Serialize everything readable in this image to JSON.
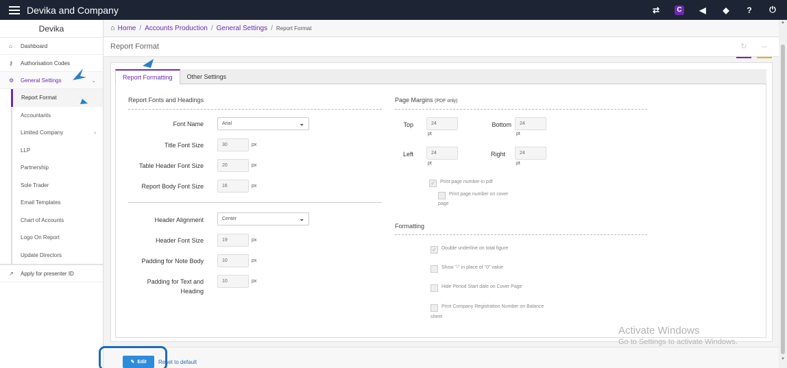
{
  "app": {
    "title": "Devika and Company"
  },
  "topbar_icons": [
    "exchange-icon",
    "brand-c-icon",
    "megaphone-icon",
    "tag-icon",
    "help-icon",
    "power-icon"
  ],
  "sidebar": {
    "company": "Devika",
    "items": [
      {
        "label": "Dashboard",
        "icon": "dashboard-icon"
      },
      {
        "label": "Authorisation Codes",
        "icon": "key-icon"
      },
      {
        "label": "General Settings",
        "icon": "cogs-icon"
      }
    ],
    "sub_items": [
      {
        "label": "Report Format"
      },
      {
        "label": "Accountants"
      },
      {
        "label": "Limited Company"
      },
      {
        "label": "LLP"
      },
      {
        "label": "Partnership"
      },
      {
        "label": "Sole Trader"
      },
      {
        "label": "Email Templates"
      },
      {
        "label": "Chart of Accounts"
      },
      {
        "label": "Logo On Report"
      },
      {
        "label": "Update Directors"
      }
    ],
    "presenter": {
      "label": "Apply for presenter ID"
    }
  },
  "breadcrumb": {
    "home": "Home",
    "b1": "Accounts Production",
    "b2": "General Settings",
    "current": "Report Format"
  },
  "page": {
    "title": "Report Format"
  },
  "tabs": {
    "active": "Report Formatting",
    "other": "Other Settings"
  },
  "fonts_section": {
    "title": "Report Fonts and Headings",
    "font_name_label": "Font Name",
    "font_name_value": "Arial",
    "title_size_label": "Title Font Size",
    "title_size_value": "30",
    "table_header_label": "Table Header Font Size",
    "table_header_value": "20",
    "body_size_label": "Report Body Font Size",
    "body_size_value": "16",
    "header_align_label": "Header Alignment",
    "header_align_value": "Center",
    "header_font_label": "Header Font Size",
    "header_font_value": "19",
    "padding_note_label": "Padding for Note Body",
    "padding_note_value": "10",
    "padding_text_label_1": "Padding for Text and",
    "padding_text_label_2": "Heading",
    "padding_text_value": "10",
    "unit": "px"
  },
  "margins_section": {
    "title": "Page Margins",
    "title_note": "(PDF only)",
    "top_label": "Top",
    "top_value": "24",
    "bottom_label": "Bottom",
    "bottom_value": "24",
    "left_label": "Left",
    "left_value": "24",
    "right_label": "Right",
    "right_value": "24",
    "unit": "pt",
    "print_page_number": "Print page number in pdf",
    "print_page_number_cover_1": "Print page number on cover",
    "print_page_number_cover_2": "page"
  },
  "formatting_section": {
    "title": "Formatting",
    "double_underline": "Double underline on total figure",
    "show_dash": "Show \"-\" in place of \"0\" value",
    "hide_period": "Hide Period Start date on Cover Page",
    "print_reg_1": "Print Company Registration Number on Balance",
    "print_reg_2": "sheet"
  },
  "actions": {
    "edit": "Edit",
    "reset": "Reset to default"
  },
  "watermark": {
    "line1": "Activate Windows",
    "line2": "Go to Settings to activate Windows."
  },
  "colors": {
    "topbar": "#1d2433",
    "accent": "#6b2bb0",
    "button": "#2d8cdb"
  }
}
